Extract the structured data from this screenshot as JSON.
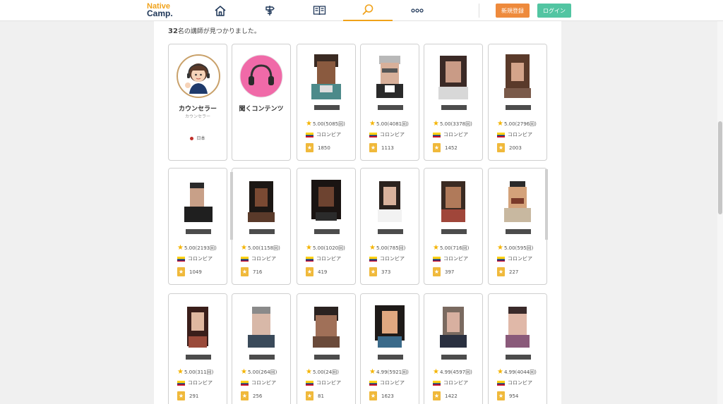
{
  "header": {
    "logo_line1": "Native",
    "logo_line2": "Camp.",
    "nav": [
      {
        "icon": "home-icon"
      },
      {
        "icon": "signpost-icon"
      },
      {
        "icon": "book-icon"
      },
      {
        "icon": "search-icon",
        "active": true
      },
      {
        "icon": "more-icon"
      }
    ],
    "signup_label": "新規登録",
    "login_label": "ログイン",
    "accent_color": "#f0a21a"
  },
  "results": {
    "count": "32",
    "suffix": "名の講師が見つかりました。"
  },
  "special_cards": [
    {
      "title": "カウンセラー",
      "subtitle": "カウンセラー",
      "country": "日本"
    },
    {
      "title": "聞くコンテンツ"
    }
  ],
  "teachers": [
    {
      "rating": "5.00(5085回)",
      "country": "コロンビア",
      "favorites": "1850"
    },
    {
      "rating": "5.00(4081回)",
      "country": "コロンビア",
      "favorites": "1113"
    },
    {
      "rating": "5.00(3378回)",
      "country": "コロンビア",
      "favorites": "1452"
    },
    {
      "rating": "5.00(2796回)",
      "country": "コロンビア",
      "favorites": "2003"
    },
    {
      "rating": "5.00(2193回)",
      "country": "コロンビア",
      "favorites": "1049"
    },
    {
      "rating": "5.00(1158回)",
      "country": "コロンビア",
      "favorites": "716"
    },
    {
      "rating": "5.00(1020回)",
      "country": "コロンビア",
      "favorites": "419"
    },
    {
      "rating": "5.00(785回)",
      "country": "コロンビア",
      "favorites": "373"
    },
    {
      "rating": "5.00(716回)",
      "country": "コロンビア",
      "favorites": "397"
    },
    {
      "rating": "5.00(595回)",
      "country": "コロンビア",
      "favorites": "227"
    },
    {
      "rating": "5.00(311回)",
      "country": "コロンビア",
      "favorites": "291"
    },
    {
      "rating": "5.00(264回)",
      "country": "コロンビア",
      "favorites": "256"
    },
    {
      "rating": "5.00(24回)",
      "country": "コロンビア",
      "favorites": "81"
    },
    {
      "rating": "4.99(5921回)",
      "country": "コロンビア",
      "favorites": "1623"
    },
    {
      "rating": "4.99(4597回)",
      "country": "コロンビア",
      "favorites": "1422"
    },
    {
      "rating": "4.99(4044回)",
      "country": "コロンビア",
      "favorites": "954"
    }
  ]
}
